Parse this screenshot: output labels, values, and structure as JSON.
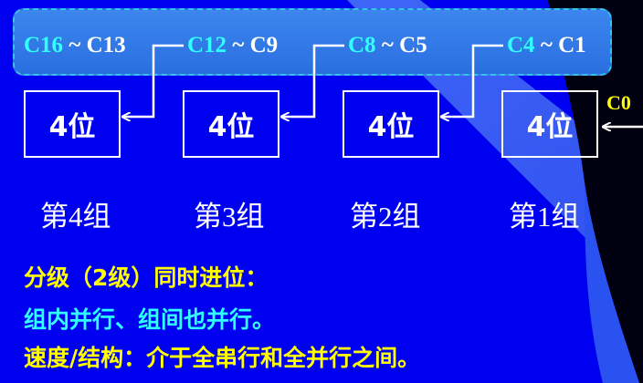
{
  "carry_labels": [
    {
      "hi": "C16",
      "sep": " ~ ",
      "lo": "C13"
    },
    {
      "hi": "C12",
      "sep": " ~ ",
      "lo": "C9"
    },
    {
      "hi": "C8",
      "sep": " ~ ",
      "lo": "C5"
    },
    {
      "hi": "C4",
      "sep": " ~ ",
      "lo": "C1"
    }
  ],
  "units": [
    "4位",
    "4位",
    "4位",
    "4位"
  ],
  "groups": [
    "第4组",
    "第3组",
    "第2组",
    "第1组"
  ],
  "carry_in": "C0",
  "notes": [
    "分级（2级）同时进位：",
    "组内并行、组间也并行。",
    "速度/结构：介于全串行和全并行之间。"
  ],
  "colors": {
    "background": "#0000f0",
    "highlight_cyan": "#30ffff",
    "highlight_yellow": "#ffff00",
    "box_border": "#ffffff"
  }
}
